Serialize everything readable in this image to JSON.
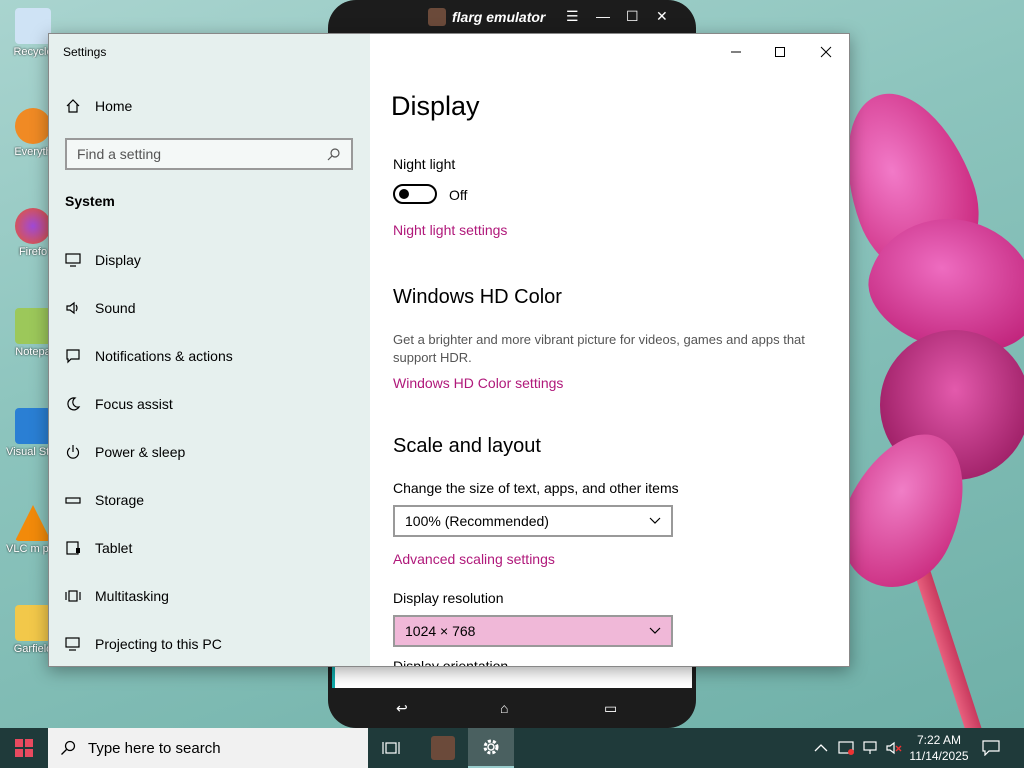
{
  "desktop": {
    "icons": [
      {
        "label": "Recycle",
        "color": "#cfe3f5"
      },
      {
        "label": "Everyth",
        "color": "#f08a24"
      },
      {
        "label": "Firefo",
        "color": "#e8572a"
      },
      {
        "label": "Notepa",
        "color": "#9cc85a"
      },
      {
        "label": "Visual St Cod",
        "color": "#2a7fd4"
      },
      {
        "label": "VLC m playe",
        "color": "#f28a0a"
      },
      {
        "label": "Garfield",
        "color": "#f2c84a"
      }
    ]
  },
  "emulator": {
    "title": "flarg emulator"
  },
  "settings": {
    "app_title": "Settings",
    "home_label": "Home",
    "search_placeholder": "Find a setting",
    "section_label": "System",
    "nav": [
      {
        "label": "Display"
      },
      {
        "label": "Sound"
      },
      {
        "label": "Notifications & actions"
      },
      {
        "label": "Focus assist"
      },
      {
        "label": "Power & sleep"
      },
      {
        "label": "Storage"
      },
      {
        "label": "Tablet"
      },
      {
        "label": "Multitasking"
      },
      {
        "label": "Projecting to this PC"
      }
    ],
    "main": {
      "page_title": "Display",
      "night_light_label": "Night light",
      "night_light_state": "Off",
      "night_light_settings_link": "Night light settings",
      "hd_color_heading": "Windows HD Color",
      "hd_color_desc": "Get a brighter and more vibrant picture for videos, games and apps that support HDR.",
      "hd_color_link": "Windows HD Color settings",
      "scale_heading": "Scale and layout",
      "scale_label": "Change the size of text, apps, and other items",
      "scale_value": "100% (Recommended)",
      "advanced_scaling_link": "Advanced scaling settings",
      "resolution_label": "Display resolution",
      "resolution_value": "1024 × 768",
      "orientation_label_partial": "Display orientation"
    },
    "accent_color": "#b0187a"
  },
  "taskbar": {
    "search_placeholder": "Type here to search",
    "time": "7:22 AM",
    "date": "11/14/2025"
  }
}
